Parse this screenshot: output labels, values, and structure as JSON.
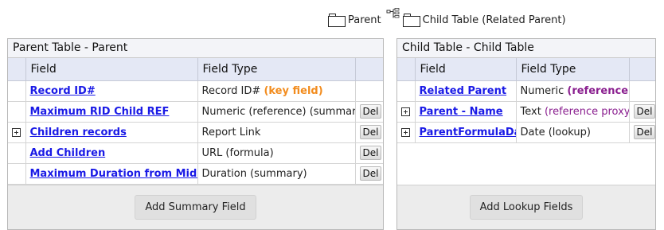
{
  "breadcrumb": {
    "parent_label": "Parent",
    "child_label": "Child Table (Related Parent)"
  },
  "parent_panel": {
    "title": "Parent Table - Parent",
    "headers": {
      "field": "Field",
      "field_type": "Field Type"
    },
    "rows": [
      {
        "field": "Record ID#",
        "type": "Record ID#",
        "type_suffix": "(key field)",
        "expandable": false,
        "deletable": false
      },
      {
        "field": "Maximum RID Child REF",
        "type": "Numeric (reference) (summary)",
        "expandable": false,
        "deletable": true
      },
      {
        "field": "Children records",
        "type": "Report Link",
        "expandable": true,
        "deletable": true
      },
      {
        "field": "Add Children",
        "type": "URL (formula)",
        "expandable": false,
        "deletable": true
      },
      {
        "field": "Maximum Duration from Midnight",
        "type": "Duration (summary)",
        "expandable": false,
        "deletable": true
      }
    ],
    "del_label": "Del",
    "footer_button": "Add Summary Field"
  },
  "child_panel": {
    "title": "Child Table - Child Table",
    "headers": {
      "field": "Field",
      "field_type": "Field Type"
    },
    "rows": [
      {
        "field": "Related Parent",
        "type": "Numeric",
        "type_suffix": "(reference)",
        "expandable": false,
        "deletable": false
      },
      {
        "field": "Parent - Name",
        "type": "Text",
        "type_suffix": "(reference proxy)",
        "expandable": true,
        "deletable": true
      },
      {
        "field": "ParentFormulaDate",
        "type": "Date (lookup)",
        "expandable": true,
        "deletable": true
      }
    ],
    "del_label": "Del",
    "footer_button": "Add Lookup Fields"
  },
  "colors": {
    "link": "#1a1ae6",
    "key_field": "#f28c1e",
    "reference": "#8a1f8f",
    "header_bg": "#e4e8f5"
  },
  "icons": [
    "folder-icon",
    "relationship-icon",
    "expand-icon"
  ]
}
